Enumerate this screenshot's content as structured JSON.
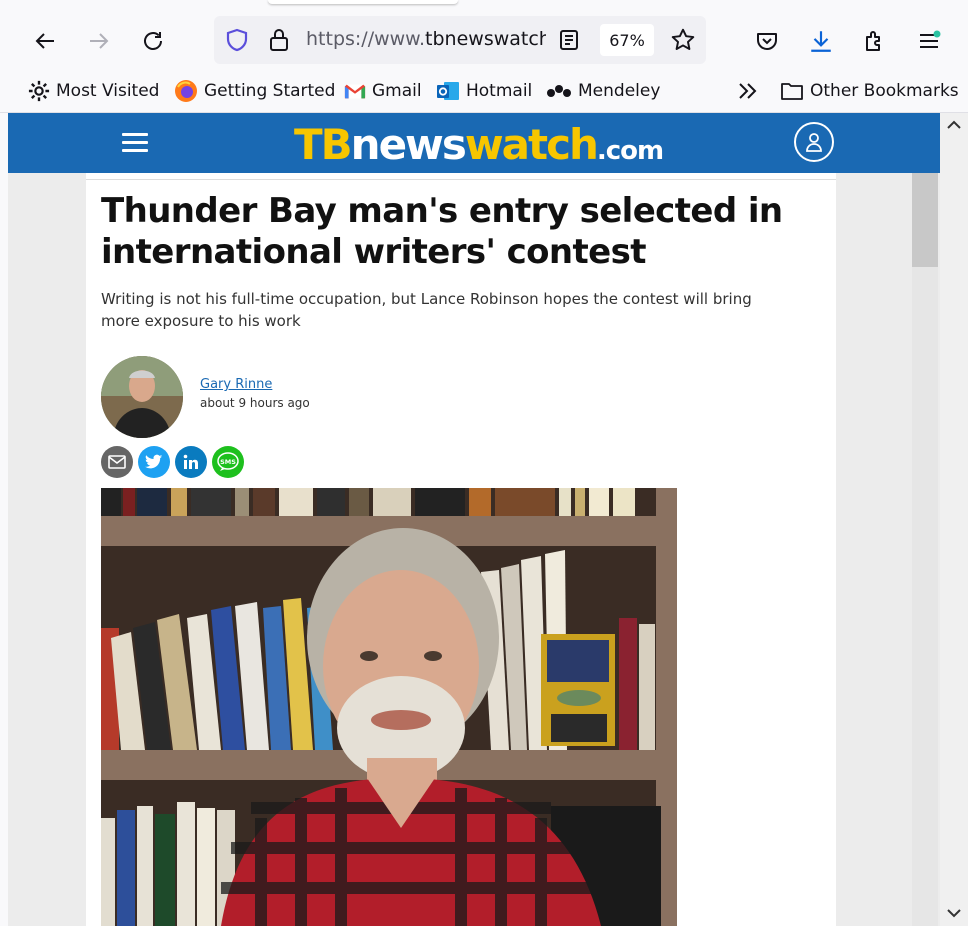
{
  "browser": {
    "url_prefix": "https://www.",
    "url_domain": "tbnewswatch",
    "url_suffix": ".",
    "zoom": "67%"
  },
  "bookmarks": [
    {
      "label": "Most Visited",
      "icon": "gear-icon"
    },
    {
      "label": "Getting Started",
      "icon": "firefox-icon"
    },
    {
      "label": "Gmail",
      "icon": "gmail-icon"
    },
    {
      "label": "Hotmail",
      "icon": "outlook-icon"
    },
    {
      "label": "Mendeley",
      "icon": "mendeley-icon"
    }
  ],
  "other_bookmarks": "Other Bookmarks",
  "site": {
    "logo_tb": "TB",
    "logo_news": "news",
    "logo_watch": "watch",
    "logo_com": ".com"
  },
  "article": {
    "title": "Thunder Bay man's entry selected in international writers' contest",
    "subtitle": "Writing is not his full-time occupation, but Lance Robinson hopes the contest will bring more exposure to his work",
    "author": "Gary Rinne",
    "time": "about 9 hours ago",
    "share": [
      {
        "name": "email",
        "color": "#666666"
      },
      {
        "name": "twitter",
        "color": "#1da1f2"
      },
      {
        "name": "linkedin",
        "color": "#0a7bbf"
      },
      {
        "name": "sms",
        "color": "#1ec01e"
      }
    ]
  },
  "colors": {
    "header_blue": "#1a69b3",
    "logo_yellow": "#f7c600"
  }
}
